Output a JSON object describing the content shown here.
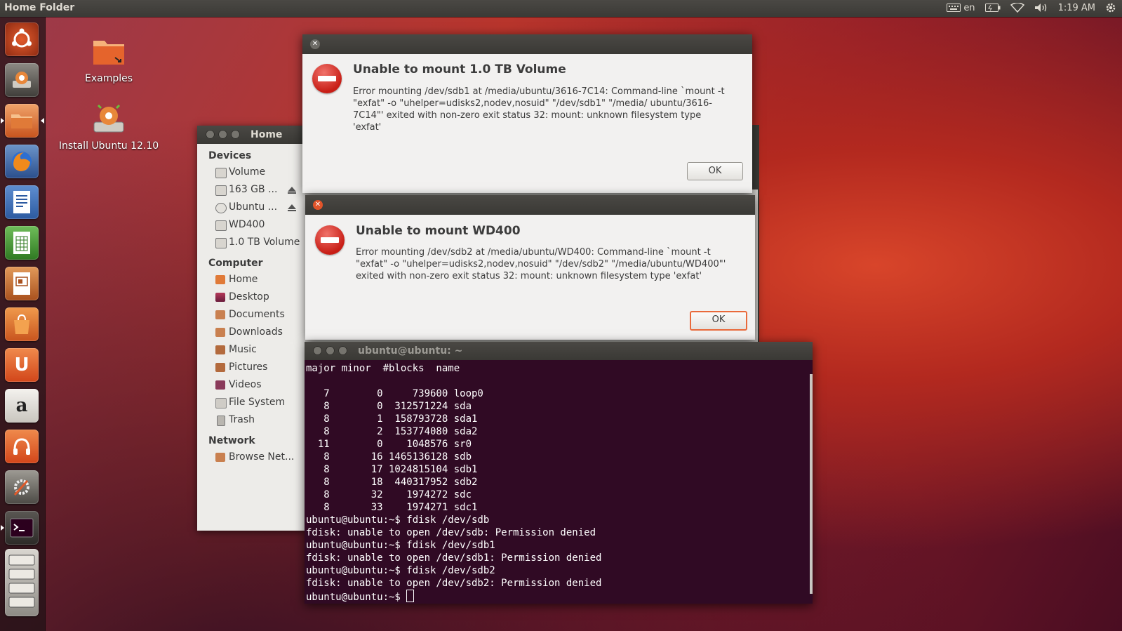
{
  "panel": {
    "title": "Home Folder",
    "lang": "en",
    "time": "1:19 AM"
  },
  "desktop": {
    "icons": [
      {
        "label": "Examples"
      },
      {
        "label": "Install Ubuntu 12.10"
      }
    ]
  },
  "file_manager": {
    "title": "Home",
    "sections": {
      "devices": "Devices",
      "computer": "Computer",
      "network": "Network"
    },
    "devices": [
      "Volume",
      "163 GB ...",
      "Ubuntu ...",
      "WD400",
      "1.0 TB Volume"
    ],
    "computer": [
      "Home",
      "Desktop",
      "Documents",
      "Downloads",
      "Music",
      "Pictures",
      "Videos",
      "File System",
      "Trash"
    ],
    "network": [
      "Browse Net..."
    ]
  },
  "dialog1": {
    "heading": "Unable to mount 1.0 TB Volume",
    "body": "Error mounting /dev/sdb1 at /media/ubuntu/3616-7C14: Command-line `mount -t \"exfat\" -o \"uhelper=udisks2,nodev,nosuid\" \"/dev/sdb1\" \"/media/ ubuntu/3616-7C14\"' exited with non-zero exit status 32: mount: unknown filesystem type 'exfat'",
    "ok": "OK"
  },
  "dialog2": {
    "heading": "Unable to mount WD400",
    "body": "Error mounting /dev/sdb2 at /media/ubuntu/WD400: Command-line `mount -t \"exfat\" -o \"uhelper=udisks2,nodev,nosuid\" \"/dev/sdb2\" \"/media/ubuntu/WD400\"' exited with non-zero exit status 32: mount: unknown filesystem type 'exfat'",
    "ok": "OK"
  },
  "terminal": {
    "title": "ubuntu@ubuntu: ~",
    "lines": [
      "major minor  #blocks  name",
      "",
      "   7        0     739600 loop0",
      "   8        0  312571224 sda",
      "   8        1  158793728 sda1",
      "   8        2  153774080 sda2",
      "  11        0    1048576 sr0",
      "   8       16 1465136128 sdb",
      "   8       17 1024815104 sdb1",
      "   8       18  440317952 sdb2",
      "   8       32    1974272 sdc",
      "   8       33    1974271 sdc1",
      "ubuntu@ubuntu:~$ fdisk /dev/sdb",
      "fdisk: unable to open /dev/sdb: Permission denied",
      "ubuntu@ubuntu:~$ fdisk /dev/sdb1",
      "fdisk: unable to open /dev/sdb1: Permission denied",
      "ubuntu@ubuntu:~$ fdisk /dev/sdb2",
      "fdisk: unable to open /dev/sdb2: Permission denied"
    ],
    "prompt": "ubuntu@ubuntu:~$ "
  },
  "colors": {
    "accent": "#e96a3b",
    "terminal_bg": "#300a24",
    "error_red": "#c81e16"
  }
}
